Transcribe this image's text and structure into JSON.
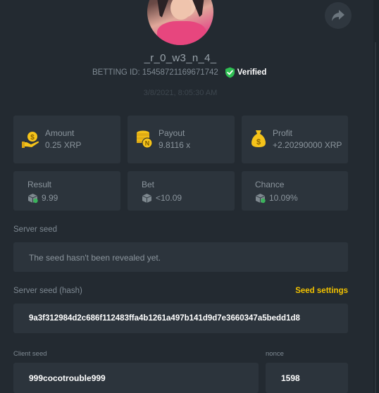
{
  "profile": {
    "username": "_r_0_w3_n_4_",
    "betting_id": "BETTING ID: 15458721169671742",
    "verified_label": "Verified",
    "timestamp": "3/8/2021, 8:05:30 AM"
  },
  "stats": {
    "amount": {
      "label": "Amount",
      "value": "0.25 XRP"
    },
    "payout": {
      "label": "Payout",
      "value": "9.8116 x"
    },
    "profit": {
      "label": "Profit",
      "value": "+2.20290000 XRP"
    },
    "result": {
      "label": "Result",
      "value": "9.99"
    },
    "bet": {
      "label": "Bet",
      "value": "<10.09"
    },
    "chance": {
      "label": "Chance",
      "value": "10.09%"
    }
  },
  "seeds": {
    "server_seed_label": "Server seed",
    "server_seed_value": "The seed hasn't been revealed yet.",
    "server_hash_label": "Server seed (hash)",
    "seed_settings_label": "Seed settings",
    "server_hash_value": "9a3f312984d2c686f112483ffa4b1261a497b141d9d7e3660347a5bedd1d8",
    "client_seed_label": "Client seed",
    "client_seed_value": "999cocotrouble999",
    "nonce_label": "nonce",
    "nonce_value": "1598"
  },
  "colors": {
    "background": "#232a31",
    "card": "#2c343c",
    "accent_yellow": "#f2c200",
    "verified_green": "#2fbf53"
  },
  "icons": [
    "share-icon",
    "verified-shield-icon",
    "money-hand-icon",
    "coin-stack-icon",
    "money-bag-icon",
    "dice-icon"
  ]
}
